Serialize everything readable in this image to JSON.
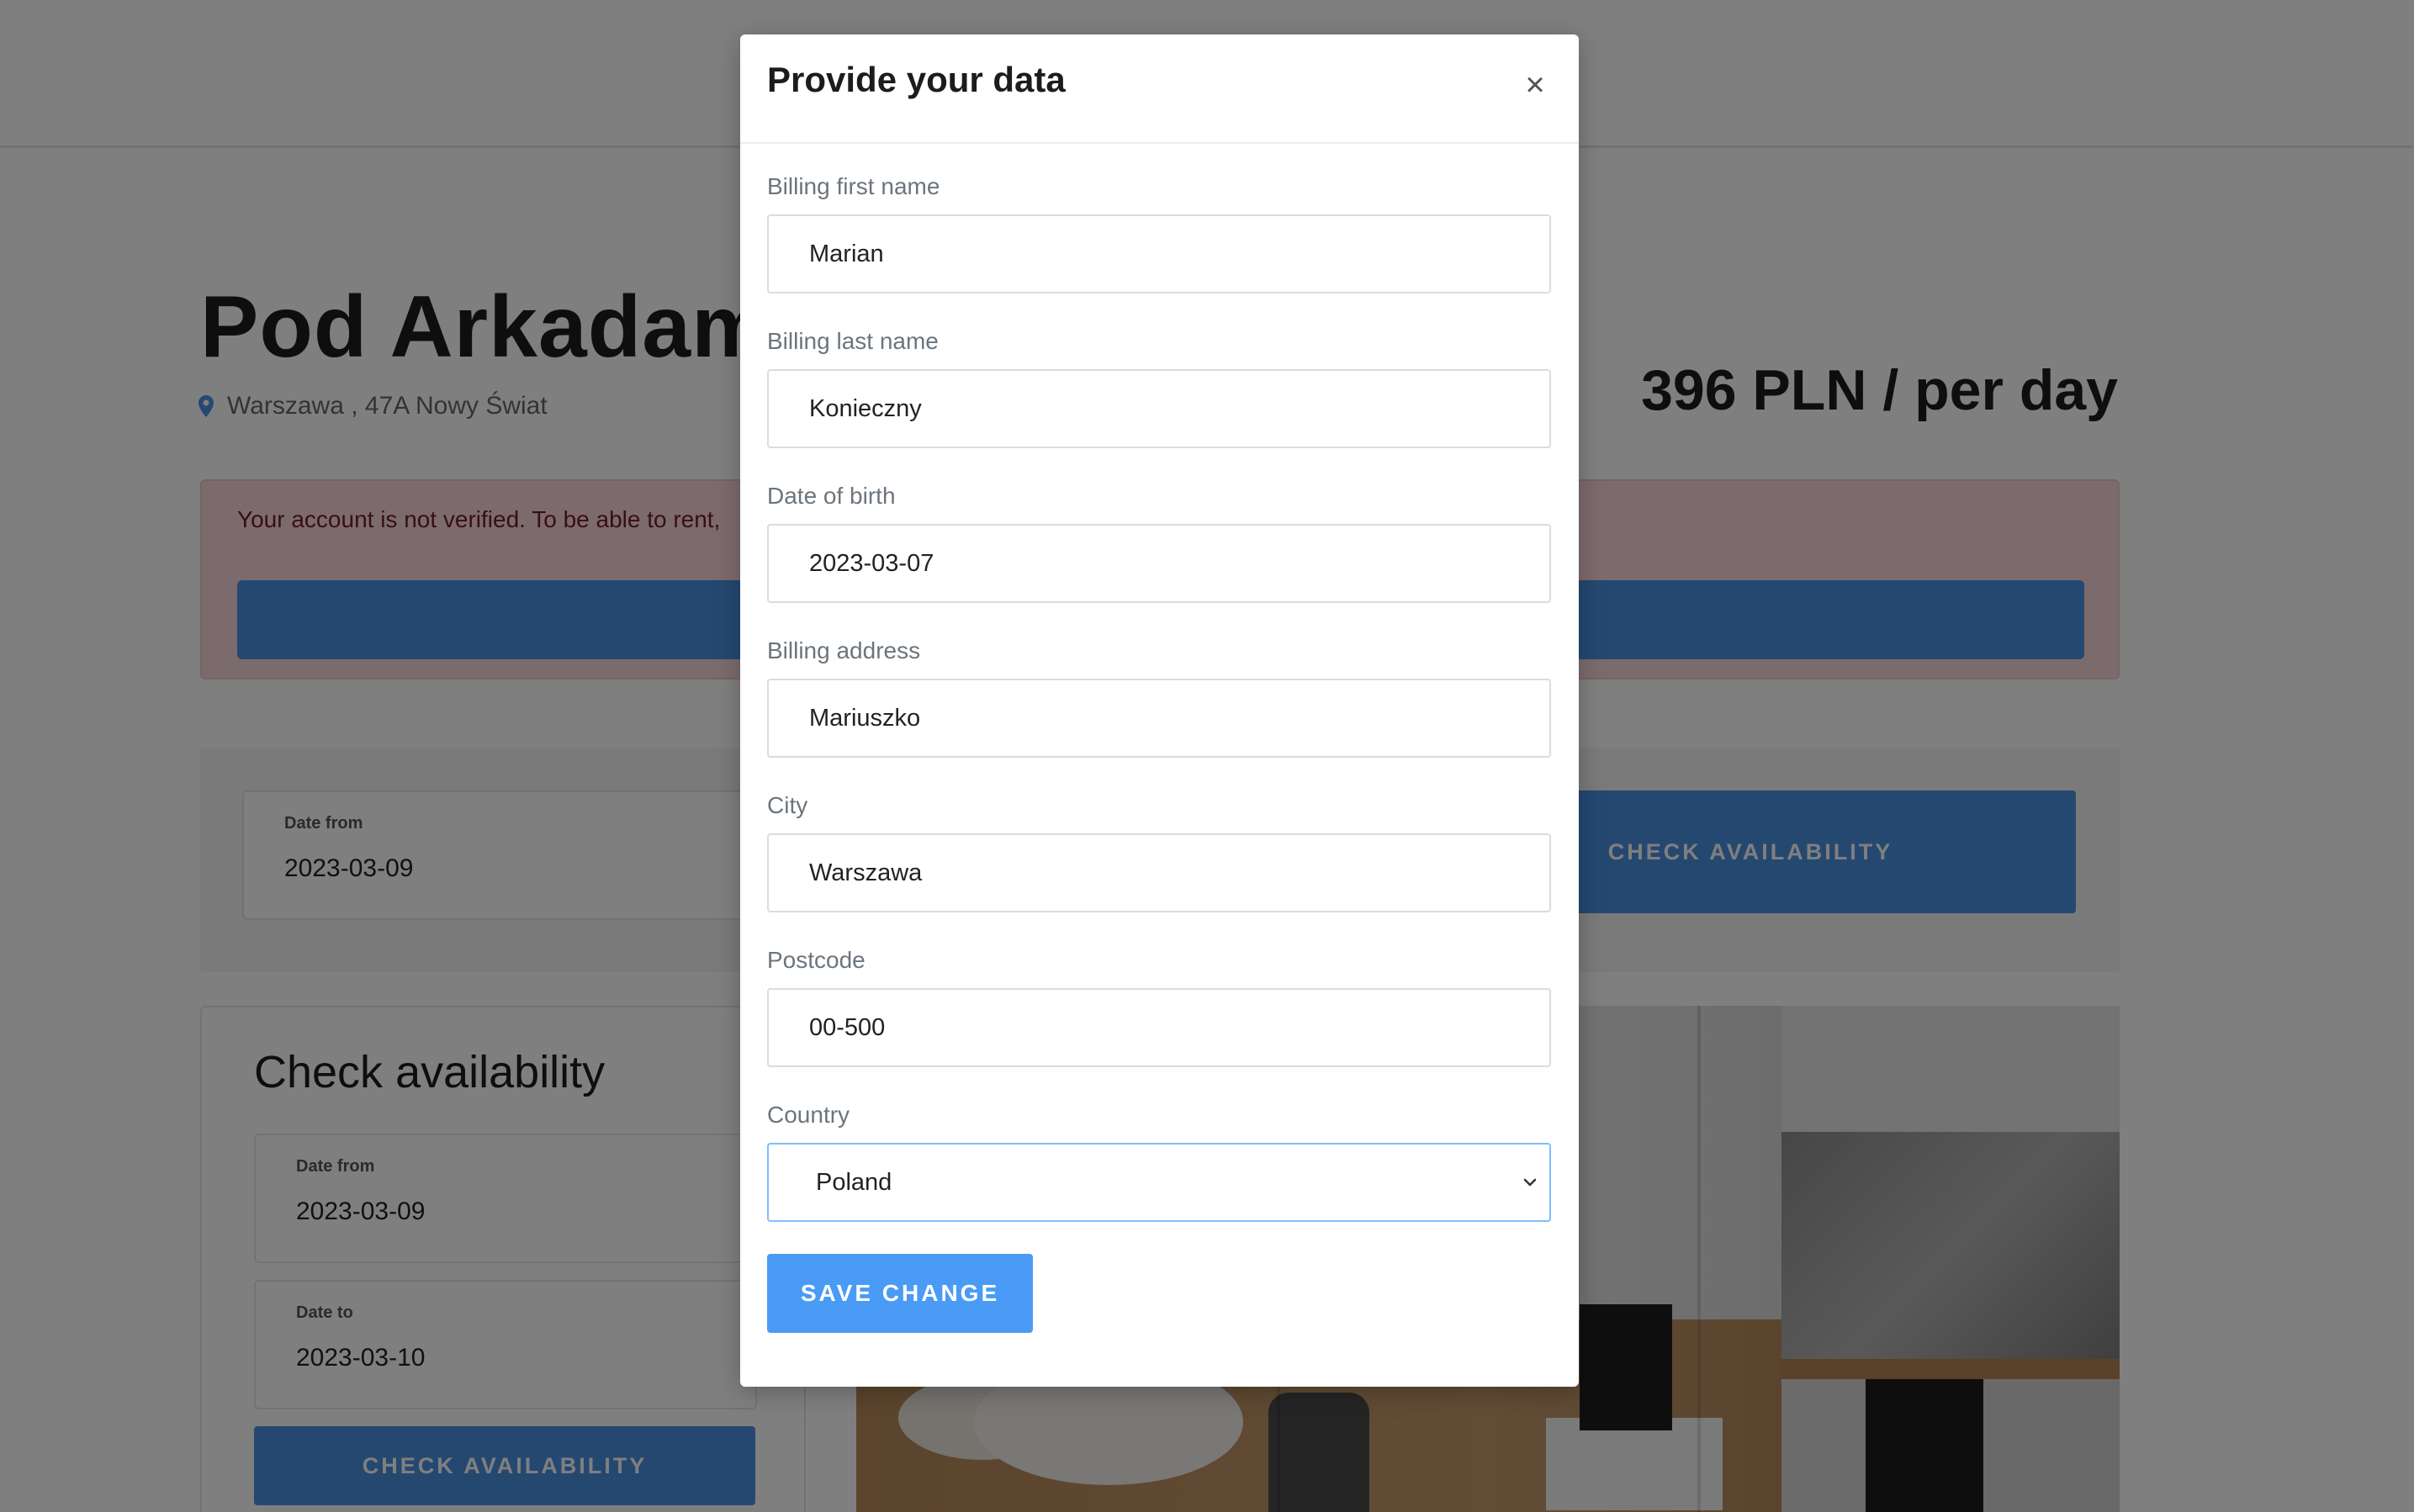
{
  "property": {
    "title": "Pod Arkadami",
    "address": "Warszawa , 47A Nowy Świat",
    "price": "396 PLN / per day",
    "alert_text": "Your account is not verified. To be able to rent,"
  },
  "search_bar": {
    "date_from_label": "Date from",
    "date_from_value": "2023-03-09",
    "check_button": "CHECK AVAILABILITY"
  },
  "availability_panel": {
    "title": "Check availability",
    "date_from_label": "Date from",
    "date_from_value": "2023-03-09",
    "date_to_label": "Date to",
    "date_to_value": "2023-03-10",
    "check_button": "CHECK AVAILABILITY"
  },
  "modal": {
    "title": "Provide your data",
    "close_icon": "×",
    "fields": {
      "first_name": {
        "label": "Billing first name",
        "value": "Marian"
      },
      "last_name": {
        "label": "Billing last name",
        "value": "Konieczny"
      },
      "birth_date": {
        "label": "Date of birth",
        "value": "2023-03-07"
      },
      "address": {
        "label": "Billing address",
        "value": "Mariuszko"
      },
      "city": {
        "label": "City",
        "value": "Warszawa"
      },
      "postcode": {
        "label": "Postcode",
        "value": "00-500"
      },
      "country": {
        "label": "Country",
        "value": "Poland"
      }
    },
    "save_button": "SAVE CHANGE"
  },
  "colors": {
    "accent": "#4a90e2",
    "save_button": "#4a9bf5",
    "alert_bg": "#f8d7da",
    "alert_text": "#721c24",
    "select_focus_border": "#80bdff"
  },
  "icons": {
    "location": "map-pin-icon",
    "close": "close-icon",
    "select": "chevron-down-icon"
  }
}
